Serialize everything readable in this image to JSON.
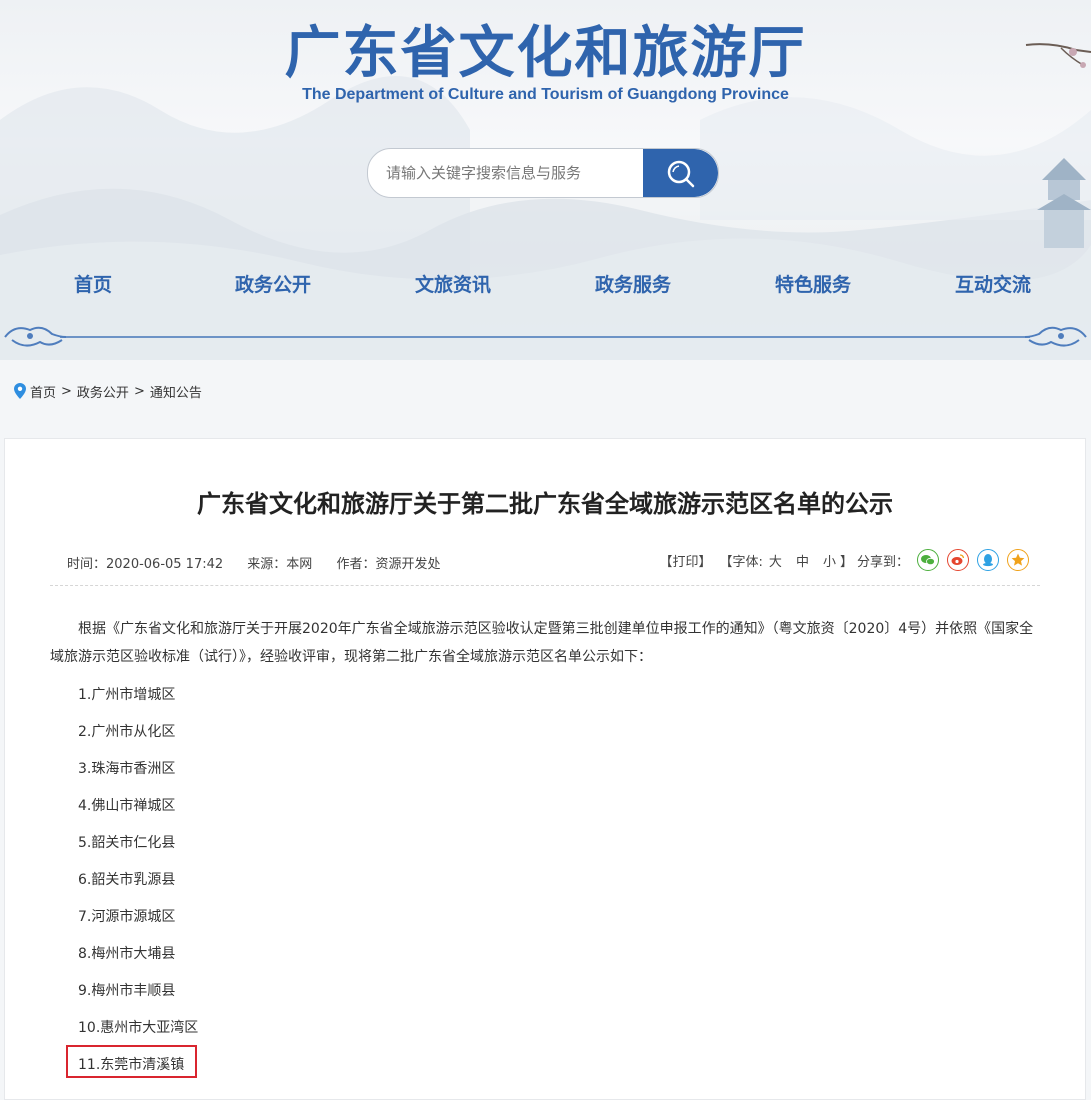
{
  "header": {
    "title": "广东省文化和旅游厅",
    "subtitle": "The Department of Culture and Tourism of Guangdong Province"
  },
  "search": {
    "placeholder": "请输入关键字搜索信息与服务",
    "icon": "search-icon"
  },
  "nav": {
    "items": [
      {
        "label": "首页"
      },
      {
        "label": "政务公开"
      },
      {
        "label": "文旅资讯"
      },
      {
        "label": "政务服务"
      },
      {
        "label": "特色服务"
      },
      {
        "label": "互动交流"
      }
    ]
  },
  "breadcrumb": {
    "items": [
      "首页",
      "政务公开",
      "通知公告"
    ],
    "separator": ">"
  },
  "article": {
    "title": "广东省文化和旅游厅关于第二批广东省全域旅游示范区名单的公示",
    "meta": {
      "time": "时间：2020-06-05 17:42",
      "source": "来源：本网",
      "author": "作者：资源开发处"
    },
    "tools": {
      "print": "【打印】",
      "font_label": "【字体:",
      "font_large": "大",
      "font_medium": "中",
      "font_small": "小",
      "font_end": "】",
      "share_label": "分享到：",
      "share_icons": [
        "wechat-icon",
        "weibo-icon",
        "qq-icon",
        "favorite-icon"
      ]
    },
    "paragraph": "根据《广东省文化和旅游厅关于开展2020年广东省全域旅游示范区验收认定暨第三批创建单位申报工作的通知》（粤文旅资〔2020〕4号）并依照《国家全域旅游示范区验收标准（试行）》，经验收评审，现将第二批广东省全域旅游示范区名单公示如下：",
    "list": [
      "1.广州市增城区",
      "2.广州市从化区",
      "3.珠海市香洲区",
      "4.佛山市禅城区",
      "5.韶关市仁化县",
      "6.韶关市乳源县",
      "7.河源市源城区",
      "8.梅州市大埔县",
      "9.梅州市丰顺县",
      "10.惠州市大亚湾区",
      "11.东莞市清溪镇"
    ]
  },
  "colors": {
    "brand": "#2f64ad",
    "highlight": "#d9252f",
    "wechat": "#4caf3d",
    "weibo": "#e5462f",
    "qq": "#2ea1e3",
    "favorite": "#f0a21b"
  }
}
